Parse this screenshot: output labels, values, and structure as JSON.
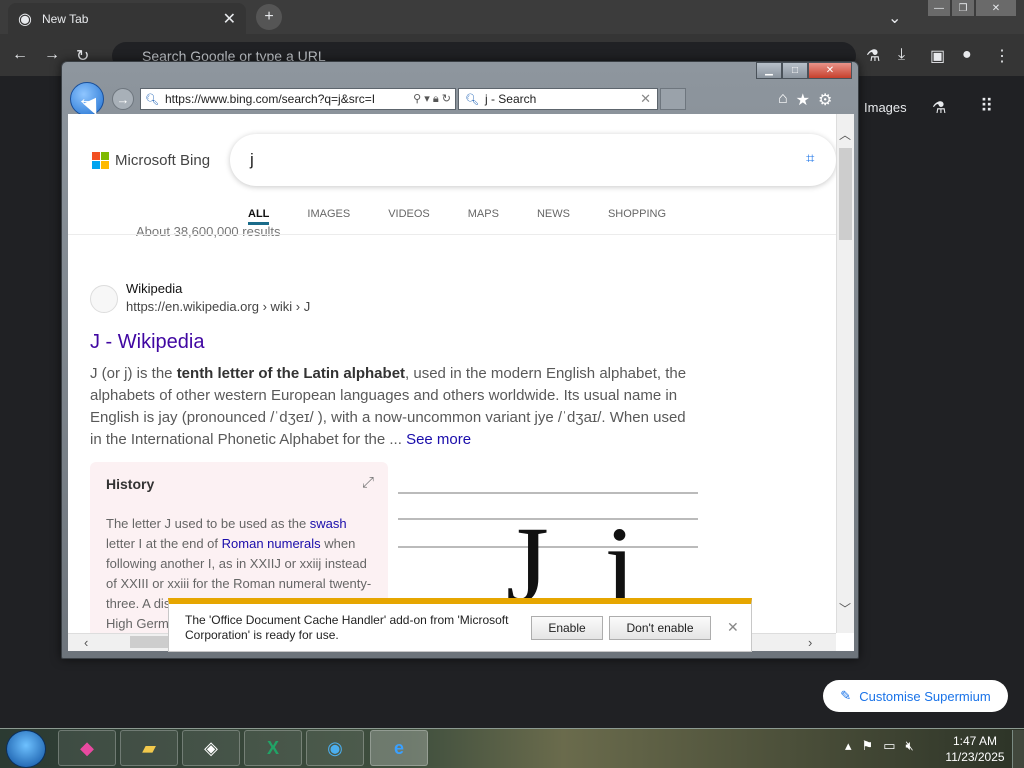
{
  "chrome": {
    "tab_title": "New Tab",
    "omnibox_placeholder": "Search Google or type a URL",
    "images_link": "Images",
    "customise_label": "Customise Supermium"
  },
  "ie": {
    "address_url": "https://www.bing.com/search?q=j&src=I",
    "tab_title": "j - Search",
    "bing_logo_text": "Microsoft Bing",
    "search_query": "j",
    "scopes": [
      {
        "label": "ALL",
        "active": true
      },
      {
        "label": "IMAGES",
        "active": false
      },
      {
        "label": "VIDEOS",
        "active": false
      },
      {
        "label": "MAPS",
        "active": false
      },
      {
        "label": "NEWS",
        "active": false
      },
      {
        "label": "SHOPPING",
        "active": false
      }
    ],
    "result_count": "About 38,600,000 results",
    "result": {
      "site_name": "Wikipedia",
      "site_url": "https://en.wikipedia.org › wiki › J",
      "title": "J - Wikipedia",
      "snippet_pre": "J (or j) is the ",
      "snippet_bold": "tenth letter of the Latin alphabet",
      "snippet_post": ", used in the modern English alphabet, the alphabets of other western European languages and others worldwide. Its usual name in English is jay (pronounced /ˈdʒeɪ/ ), with a now-uncommon variant jye /ˈdʒaɪ/. When used in the International Phonetic Alphabet for the ... ",
      "see_more": "See more",
      "history_title": "History",
      "history_p1": "The letter J used to be used as the ",
      "history_link1": "swash",
      "history_p2": " letter I at the end of ",
      "history_link2": "Roman numerals",
      "history_p3": " when following another I, as in XXIIJ or xxiij instead of XXIII or xxiii for the Roman numeral twenty-three. A distinctive usage emerged in Middle High German. (or variant",
      "image_letters": "J j"
    },
    "notification": {
      "message": "The 'Office Document Cache Handler' add-on from 'Microsoft Corporation' is ready for use.",
      "enable_label": "Enable",
      "dont_enable_label": "Don't enable"
    }
  },
  "taskbar": {
    "time": "1:47 AM",
    "date": "11/23/2025"
  },
  "colors": {
    "bing_blue_link": "#1a0dab",
    "result_title": "#4007a2",
    "notif_bar": "#e6a600",
    "ms_red": "#f25022",
    "ms_green": "#7fba00",
    "ms_blue": "#00a4ef",
    "ms_yellow": "#ffb900"
  }
}
